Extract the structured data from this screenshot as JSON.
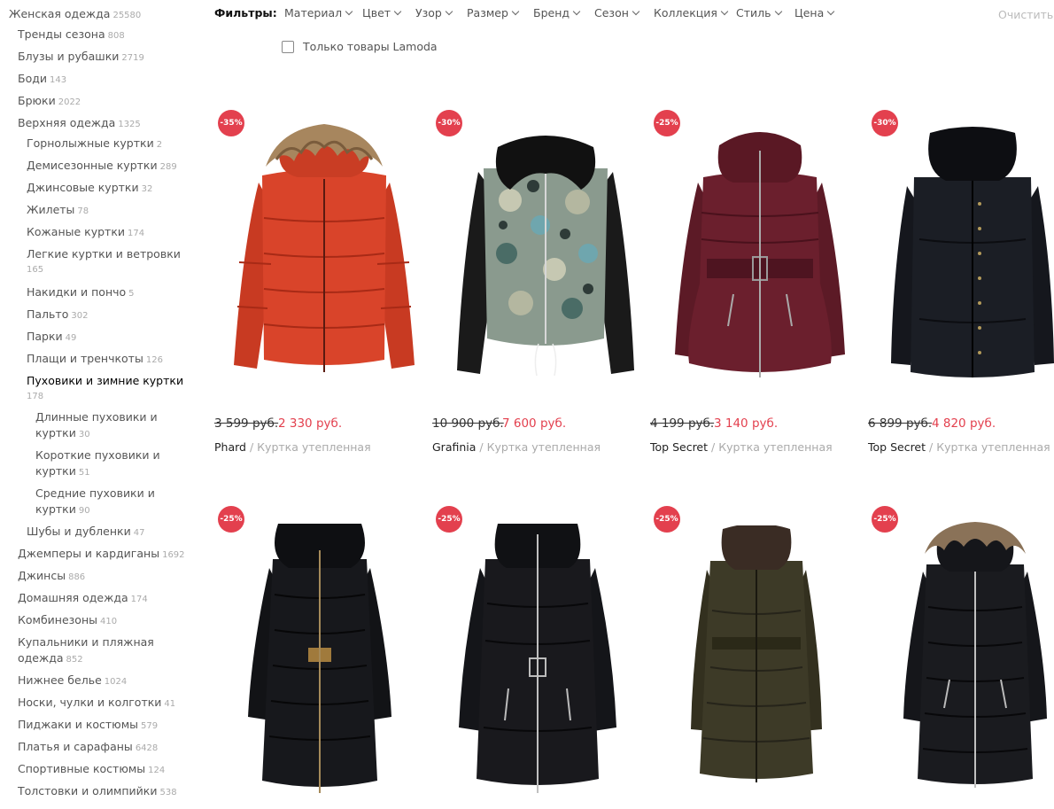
{
  "sidebar": {
    "categories": [
      {
        "label": "Женская одежда",
        "count": "25580"
      },
      {
        "label": "Тренды сезона",
        "count": "808"
      },
      {
        "label": "Блузы и рубашки",
        "count": "2719"
      },
      {
        "label": "Боди",
        "count": "143"
      },
      {
        "label": "Брюки",
        "count": "2022"
      },
      {
        "label": "Верхняя одежда",
        "count": "1325"
      },
      {
        "label": "Горнолыжные куртки",
        "count": "2"
      },
      {
        "label": "Демисезонные куртки",
        "count": "289"
      },
      {
        "label": "Джинсовые куртки",
        "count": "32"
      },
      {
        "label": "Жилеты",
        "count": "78"
      },
      {
        "label": "Кожаные куртки",
        "count": "174"
      },
      {
        "label": "Легкие куртки и ветровки",
        "count": "165"
      },
      {
        "label": "Накидки и пончо",
        "count": "5"
      },
      {
        "label": "Пальто",
        "count": "302"
      },
      {
        "label": "Парки",
        "count": "49"
      },
      {
        "label": "Плащи и тренчкоты",
        "count": "126"
      },
      {
        "label": "Пуховики и зимние куртки",
        "count": "178"
      },
      {
        "label1": "Длинные пуховики и",
        "label2": "куртки",
        "count": "30"
      },
      {
        "label1": "Короткие пуховики и",
        "label2": "куртки",
        "count": "51"
      },
      {
        "label1": "Средние пуховики и",
        "label2": "куртки",
        "count": "90"
      },
      {
        "label": "Шубы и дубленки",
        "count": "47"
      },
      {
        "label": "Джемперы и кардиганы",
        "count": "1692"
      },
      {
        "label": "Джинсы",
        "count": "886"
      },
      {
        "label": "Домашняя одежда",
        "count": "174"
      },
      {
        "label": "Комбинезоны",
        "count": "410"
      },
      {
        "label1": "Купальники и пляжная",
        "label2": "одежда",
        "count": "852"
      },
      {
        "label": "Нижнее белье",
        "count": "1024"
      },
      {
        "label": "Носки, чулки и колготки",
        "count": "41"
      },
      {
        "label": "Пиджаки и костюмы",
        "count": "579"
      },
      {
        "label": "Платья и сарафаны",
        "count": "6428"
      },
      {
        "label": "Спортивные костюмы",
        "count": "124"
      },
      {
        "label": "Толстовки и олимпийки",
        "count": "538"
      }
    ]
  },
  "filters": {
    "title": "Фильтры:",
    "items": [
      "Материал",
      "Цвет",
      "Узор",
      "Размер",
      "Бренд",
      "Сезон",
      "Коллекция",
      "Стиль",
      "Цена"
    ],
    "clear": "Очистить ф",
    "lamoda_only": "Только товары Lamoda",
    "lamoda_only_checked": false
  },
  "products": [
    {
      "discount": "-35%",
      "old_price": "3 599 руб.",
      "new_price": "2 330 руб.",
      "brand": "Phard",
      "separator": "/",
      "type": "Куртка утепленная",
      "image_icon": "red-puffer-jacket-fur-hood-icon"
    },
    {
      "discount": "-30%",
      "old_price": "10 900 руб.",
      "new_price": "7 600 руб.",
      "brand": "Grafinia",
      "separator": "/",
      "type": "Куртка утепленная",
      "image_icon": "printed-jacket-leather-sleeves-icon"
    },
    {
      "discount": "-25%",
      "old_price": "4 199 руб.",
      "new_price": "3 140 руб.",
      "brand": "Top Secret",
      "separator": "/",
      "type": "Куртка утепленная",
      "image_icon": "burgundy-quilted-coat-icon"
    },
    {
      "discount": "-30%",
      "old_price": "6 899 руб.",
      "new_price": "4 820 руб.",
      "brand": "Top Secret",
      "separator": "/",
      "type": "Куртка утепленная",
      "image_icon": "black-quilted-coat-fur-collar-icon"
    },
    {
      "discount": "-25%",
      "image_icon": "black-long-puffer-belt-icon"
    },
    {
      "discount": "-25%",
      "image_icon": "black-hooded-puffer-belt-icon"
    },
    {
      "discount": "-25%",
      "image_icon": "olive-puffer-coat-fur-collar-icon"
    },
    {
      "discount": "-25%",
      "image_icon": "black-puffer-fur-hood-icon"
    }
  ],
  "colors": {
    "accent": "#e3404e",
    "text": "#333333",
    "muted": "#aaaaaa"
  }
}
